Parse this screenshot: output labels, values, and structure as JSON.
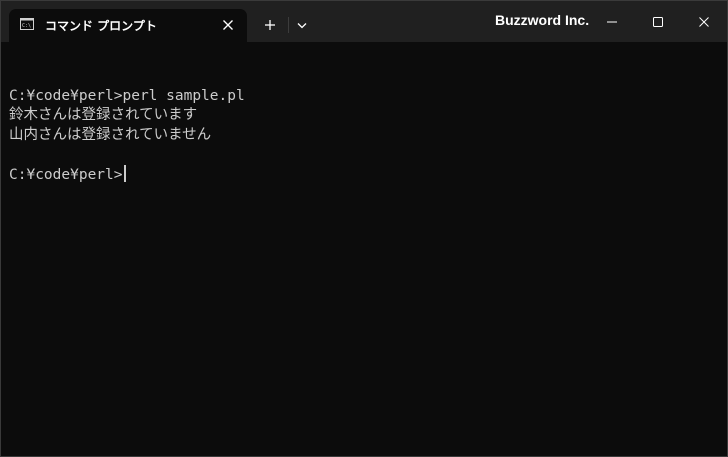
{
  "tab": {
    "icon": "cmd-icon",
    "title": "コマンド プロンプト",
    "close_icon": "close-icon"
  },
  "toolbar": {
    "new_tab_icon": "plus-icon",
    "dropdown_icon": "chevron-down-icon"
  },
  "window": {
    "title": "Buzzword Inc.",
    "minimize_icon": "minimize-icon",
    "maximize_icon": "maximize-icon",
    "close_icon": "close-icon"
  },
  "terminal": {
    "lines": [
      "",
      "C:¥code¥perl>perl sample.pl",
      "鈴木さんは登録されています",
      "山内さんは登録されていません",
      ""
    ],
    "prompt": "C:¥code¥perl>"
  },
  "colors": {
    "background": "#0c0c0c",
    "titlebar": "#202020",
    "text": "#cccccc"
  }
}
